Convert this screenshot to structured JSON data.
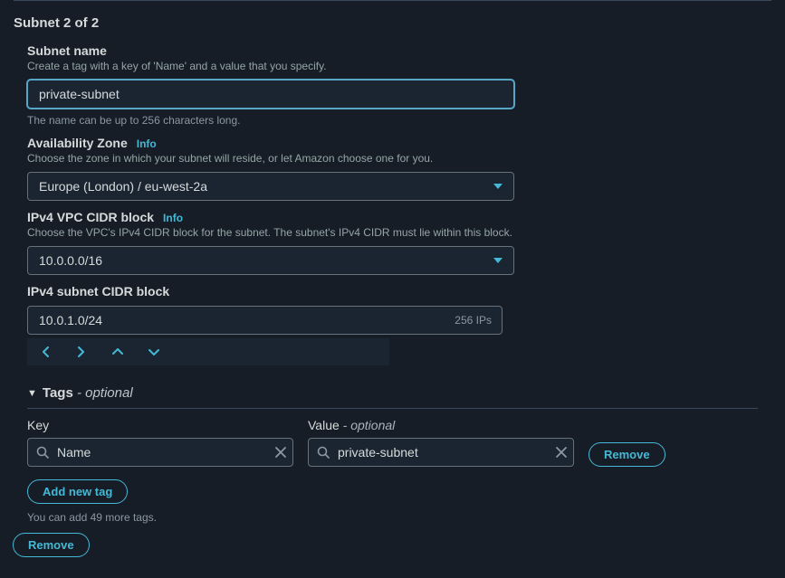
{
  "panel": {
    "title": "Subnet 2 of 2"
  },
  "subnet_name": {
    "label": "Subnet name",
    "desc": "Create a tag with a key of 'Name' and a value that you specify.",
    "value": "private-subnet",
    "helper": "The name can be up to 256 characters long."
  },
  "az": {
    "label": "Availability Zone",
    "info": "Info",
    "desc": "Choose the zone in which your subnet will reside, or let Amazon choose one for you.",
    "value": "Europe (London) / eu-west-2a"
  },
  "vpc_cidr": {
    "label": "IPv4 VPC CIDR block",
    "info": "Info",
    "desc": "Choose the VPC's IPv4 CIDR block for the subnet. The subnet's IPv4 CIDR must lie within this block.",
    "value": "10.0.0.0/16"
  },
  "subnet_cidr": {
    "label": "IPv4 subnet CIDR block",
    "value": "10.0.1.0/24",
    "ip_count": "256 IPs"
  },
  "tags": {
    "header": "Tags",
    "optional": " - optional",
    "key_label": "Key",
    "value_label": "Value",
    "value_optional": " - optional",
    "rows": [
      {
        "key": "Name",
        "value": "private-subnet",
        "remove": "Remove"
      }
    ],
    "add_label": "Add new tag",
    "helper": "You can add 49 more tags."
  },
  "remove_subnet": "Remove"
}
